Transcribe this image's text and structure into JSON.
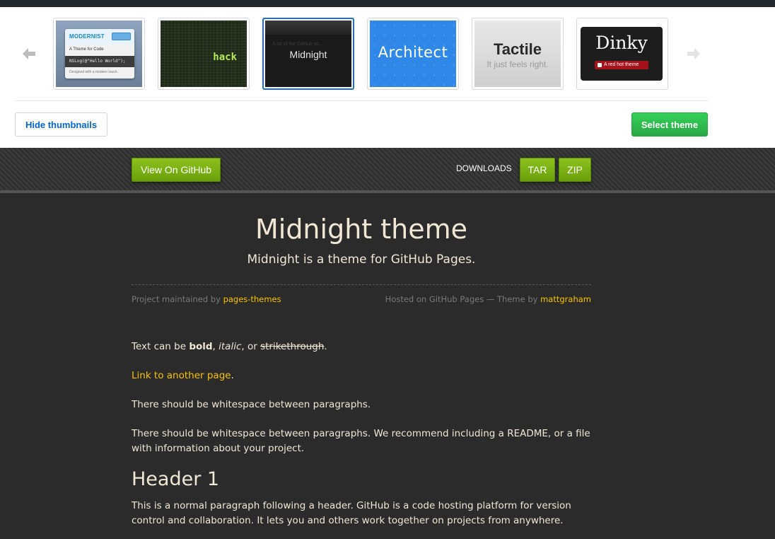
{
  "picker": {
    "thumbnails": [
      {
        "name": "Modernist",
        "logo": "MODERNIST",
        "tagline": "A Theme for Code",
        "code": "NSLog(@\"Hello World\");",
        "footer": "Designed with a modern touch."
      },
      {
        "name": "Hacker",
        "label": "hack"
      },
      {
        "name": "Midnight",
        "label": "Midnight",
        "ghost": "A lot of the GitHub sp..."
      },
      {
        "name": "Architect",
        "label": "Architect"
      },
      {
        "name": "Tactile",
        "label": "Tactile",
        "sublabel": "It just feels right."
      },
      {
        "name": "Dinky",
        "label": "Dinky",
        "badge": "A red hot theme"
      }
    ],
    "selected": "Midnight",
    "hide_thumbnails_label": "Hide thumbnails",
    "select_theme_label": "Select theme",
    "colors": {
      "select": "#28a745",
      "selected_border": "#1f6fd1"
    }
  },
  "header": {
    "view_on_github": "View On GitHub",
    "downloads_label": "DOWNLOADS",
    "tar": "TAR",
    "zip": "ZIP"
  },
  "page": {
    "title": "Midnight theme",
    "subtitle": "Midnight is a theme for GitHub Pages.",
    "maintained_prefix": "Project maintained by ",
    "maintained_link": "pages-themes",
    "hosted_prefix": "Hosted on GitHub Pages — Theme by ",
    "hosted_link": "mattgraham",
    "p1": {
      "pre": "Text can be ",
      "bold": "bold",
      "sep1": ", ",
      "italic": "italic",
      "sep2": ", or ",
      "strike": "strikethrough",
      "end": "."
    },
    "p2_link": "Link to another page",
    "p2_end": ".",
    "p3": "There should be whitespace between paragraphs.",
    "p4": "There should be whitespace between paragraphs. We recommend including a README, or a file with information about your project.",
    "h1": "Header 1",
    "p5": "This is a normal paragraph following a header. GitHub is a code hosting platform for version control and collaboration. It lets you and others work together on projects from anywhere."
  },
  "colors": {
    "link": "#f8c400",
    "text": "#f0e7d5",
    "background": "#2b2b2b",
    "green_button": "#7ab50f"
  }
}
